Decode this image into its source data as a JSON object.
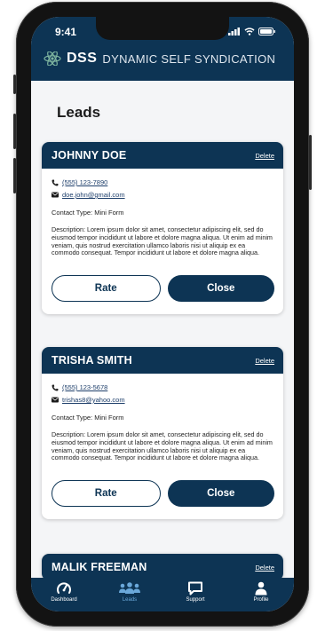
{
  "status_bar": {
    "time": "9:41"
  },
  "brand": {
    "short": "DSS",
    "long": "DYNAMIC SELF SYNDICATION"
  },
  "page": {
    "title": "Leads"
  },
  "leads": [
    {
      "name": "JOHNNY DOE",
      "delete_label": "Delete",
      "phone": "(555) 123-7890",
      "email": "doe.john@gmail.com",
      "contact_type": "Contact Type: Mini Form",
      "description": "Description: Lorem ipsum dolor sit amet, consectetur adipiscing elit, sed do eiusmod tempor incididunt ut labore et dolore magna aliqua. Ut enim ad minim veniam, quis nostrud exercitation ullamco laboris nisi ut aliquip ex ea commodo consequat. Tempor incididunt ut labore et dolore magna aliqua.",
      "rate_label": "Rate",
      "close_label": "Close"
    },
    {
      "name": "TRISHA SMITH",
      "delete_label": "Delete",
      "phone": "(555) 123-5678",
      "email": "trishas8@yahoo.com",
      "contact_type": "Contact Type: Mini Form",
      "description": "Description: Lorem ipsum dolor sit amet, consectetur adipiscing elit, sed do eiusmod tempor incididunt ut labore et dolore magna aliqua. Ut enim ad minim veniam, quis nostrud exercitation ullamco laboris nisi ut aliquip ex ea commodo consequat. Tempor incididunt ut labore et dolore magna aliqua.",
      "rate_label": "Rate",
      "close_label": "Close"
    },
    {
      "name": "MALIK FREEMAN",
      "delete_label": "Delete"
    }
  ],
  "nav": {
    "items": [
      {
        "label": "Dashboard",
        "icon": "speedometer-icon",
        "active": false
      },
      {
        "label": "Leads",
        "icon": "users-icon",
        "active": true
      },
      {
        "label": "Support",
        "icon": "chat-icon",
        "active": false
      },
      {
        "label": "Profile",
        "icon": "person-icon",
        "active": false
      }
    ]
  },
  "colors": {
    "primary": "#0d3454",
    "active_nav": "#6aa8da",
    "background": "#f4f5f7"
  }
}
